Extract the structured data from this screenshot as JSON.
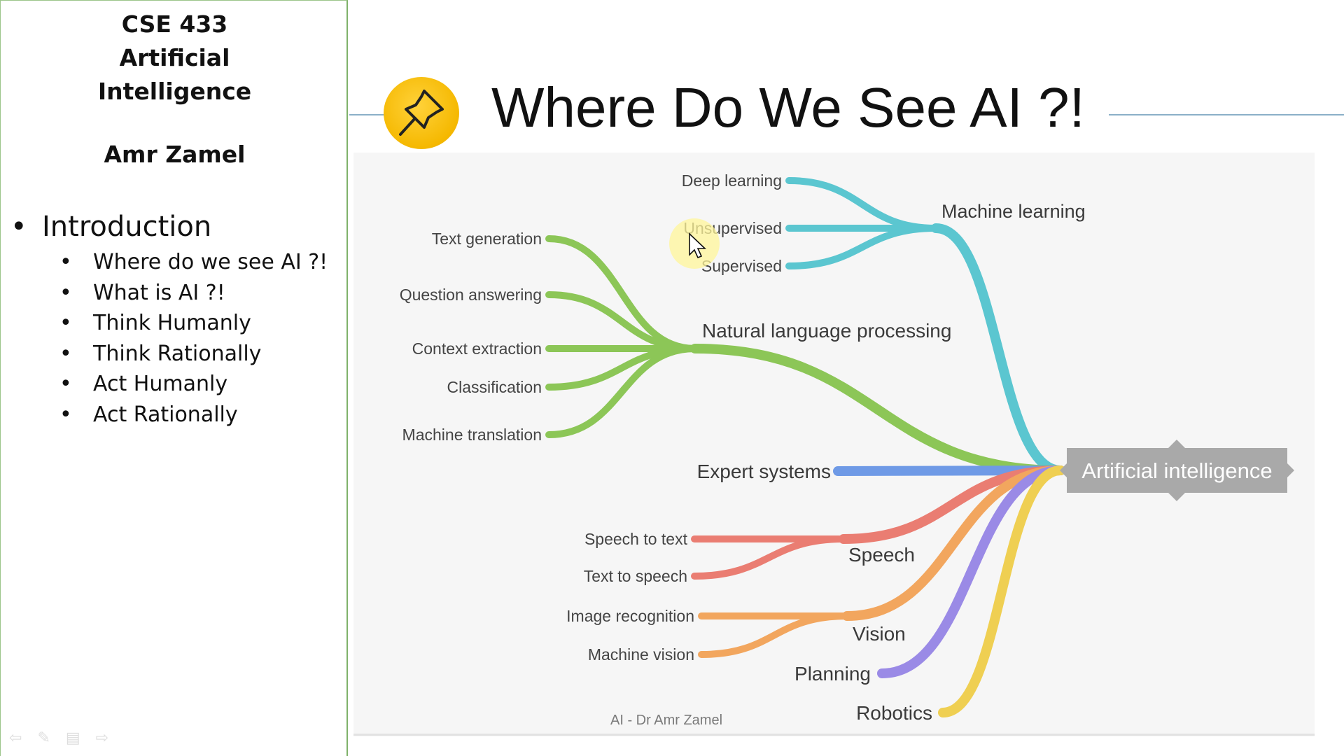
{
  "sidebar": {
    "course_lines": [
      "CSE 433",
      "Artificial",
      "Intelligence"
    ],
    "author": "Amr Zamel",
    "section_bullet": "•",
    "section": "Introduction",
    "topic_bullet": "•",
    "topics": [
      "Where do we see AI ?!",
      "What is AI ?!",
      "Think Humanly",
      "Think Rationally",
      "Act Humanly",
      "Act Rationally"
    ],
    "nav_icons": [
      "back-arrow-icon",
      "pen-icon",
      "menu-icon",
      "forward-arrow-icon"
    ]
  },
  "slide": {
    "title": "Where Do We See AI ?!",
    "icon": "pushpin-icon",
    "footer": "AI - Dr Amr Zamel"
  },
  "mindmap": {
    "root": "Artificial intelligence",
    "branches": [
      {
        "label": "Machine learning",
        "color": "#5bc6d0",
        "children": [
          "Deep learning",
          "Unsupervised",
          "Supervised"
        ]
      },
      {
        "label": "Natural language processing",
        "color": "#8cc657",
        "children": [
          "Text generation",
          "Question answering",
          "Context extraction",
          "Classification",
          "Machine translation"
        ]
      },
      {
        "label": "Expert systems",
        "color": "#6f9ae6",
        "children": []
      },
      {
        "label": "Speech",
        "color": "#ea7d72",
        "children": [
          "Speech to text",
          "Text to speech"
        ]
      },
      {
        "label": "Vision",
        "color": "#f2a65e",
        "children": [
          "Image recognition",
          "Machine vision"
        ]
      },
      {
        "label": "Planning",
        "color": "#9a8ae6",
        "children": []
      },
      {
        "label": "Robotics",
        "color": "#efcf52",
        "children": []
      }
    ],
    "colors": {
      "root_box": "#a9a9a9",
      "root_text": "#ffffff"
    }
  }
}
